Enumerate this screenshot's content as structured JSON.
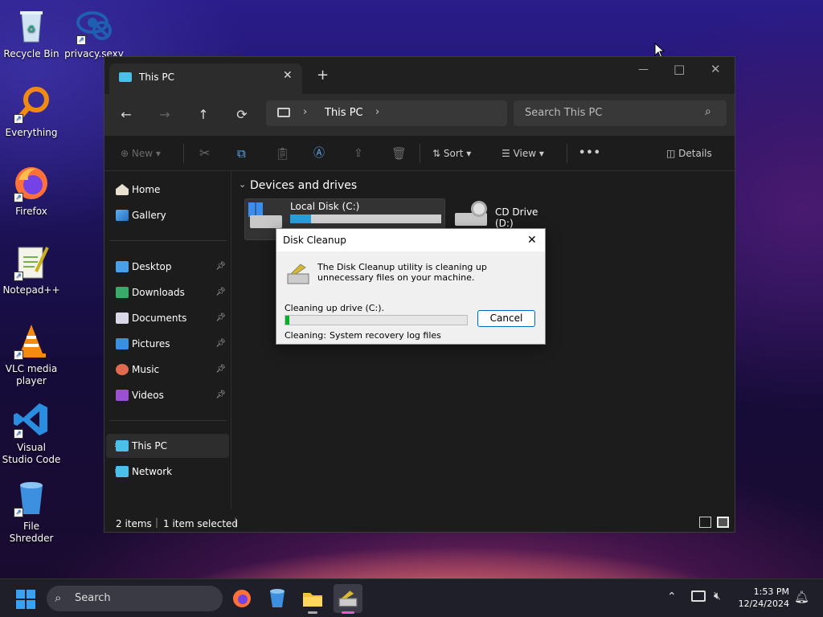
{
  "desktop": {
    "icons": [
      {
        "label": "Recycle Bin"
      },
      {
        "label": "privacy.sexy"
      },
      {
        "label": "Everything"
      },
      {
        "label": "Firefox"
      },
      {
        "label": "Notepad++"
      },
      {
        "label": "VLC media player"
      },
      {
        "label": "Visual Studio Code"
      },
      {
        "label": "File Shredder"
      }
    ]
  },
  "explorer": {
    "tab_title": "This PC",
    "new_tab": "+",
    "window_controls": {
      "minimize": "—",
      "maximize": "□",
      "close": "✕"
    },
    "nav": {
      "back": "←",
      "forward": "→",
      "up": "↑",
      "refresh": "⟳",
      "breadcrumb": "This PC",
      "search_placeholder": "Search This PC"
    },
    "commands": {
      "new": "New",
      "sort": "Sort",
      "view": "View",
      "more": "•••",
      "details": "Details"
    },
    "sidebar": {
      "home": "Home",
      "gallery": "Gallery",
      "pinned": [
        "Desktop",
        "Downloads",
        "Documents",
        "Pictures",
        "Music",
        "Videos"
      ],
      "this_pc": "This PC",
      "network": "Network"
    },
    "section_header": "Devices and drives",
    "drives": [
      {
        "name": "Local Disk (C:)",
        "usage_fraction": 0.14
      },
      {
        "name": "CD Drive (D:)"
      }
    ],
    "status": {
      "items": "2 items",
      "selected": "1 item selected"
    }
  },
  "dialog": {
    "title": "Disk Cleanup",
    "message": "The Disk Cleanup utility is cleaning up unnecessary files on your machine.",
    "progress_label": "Cleaning up drive  (C:).",
    "progress_fraction": 0.02,
    "cancel_label": "Cancel",
    "cleaning_label": "Cleaning:",
    "cleaning_value": "System recovery log files"
  },
  "taskbar": {
    "search_label": "Search",
    "time": "1:53 PM",
    "date": "12/24/2024",
    "colors": {
      "accent": "#0078d4",
      "progress": "#06b025"
    }
  }
}
